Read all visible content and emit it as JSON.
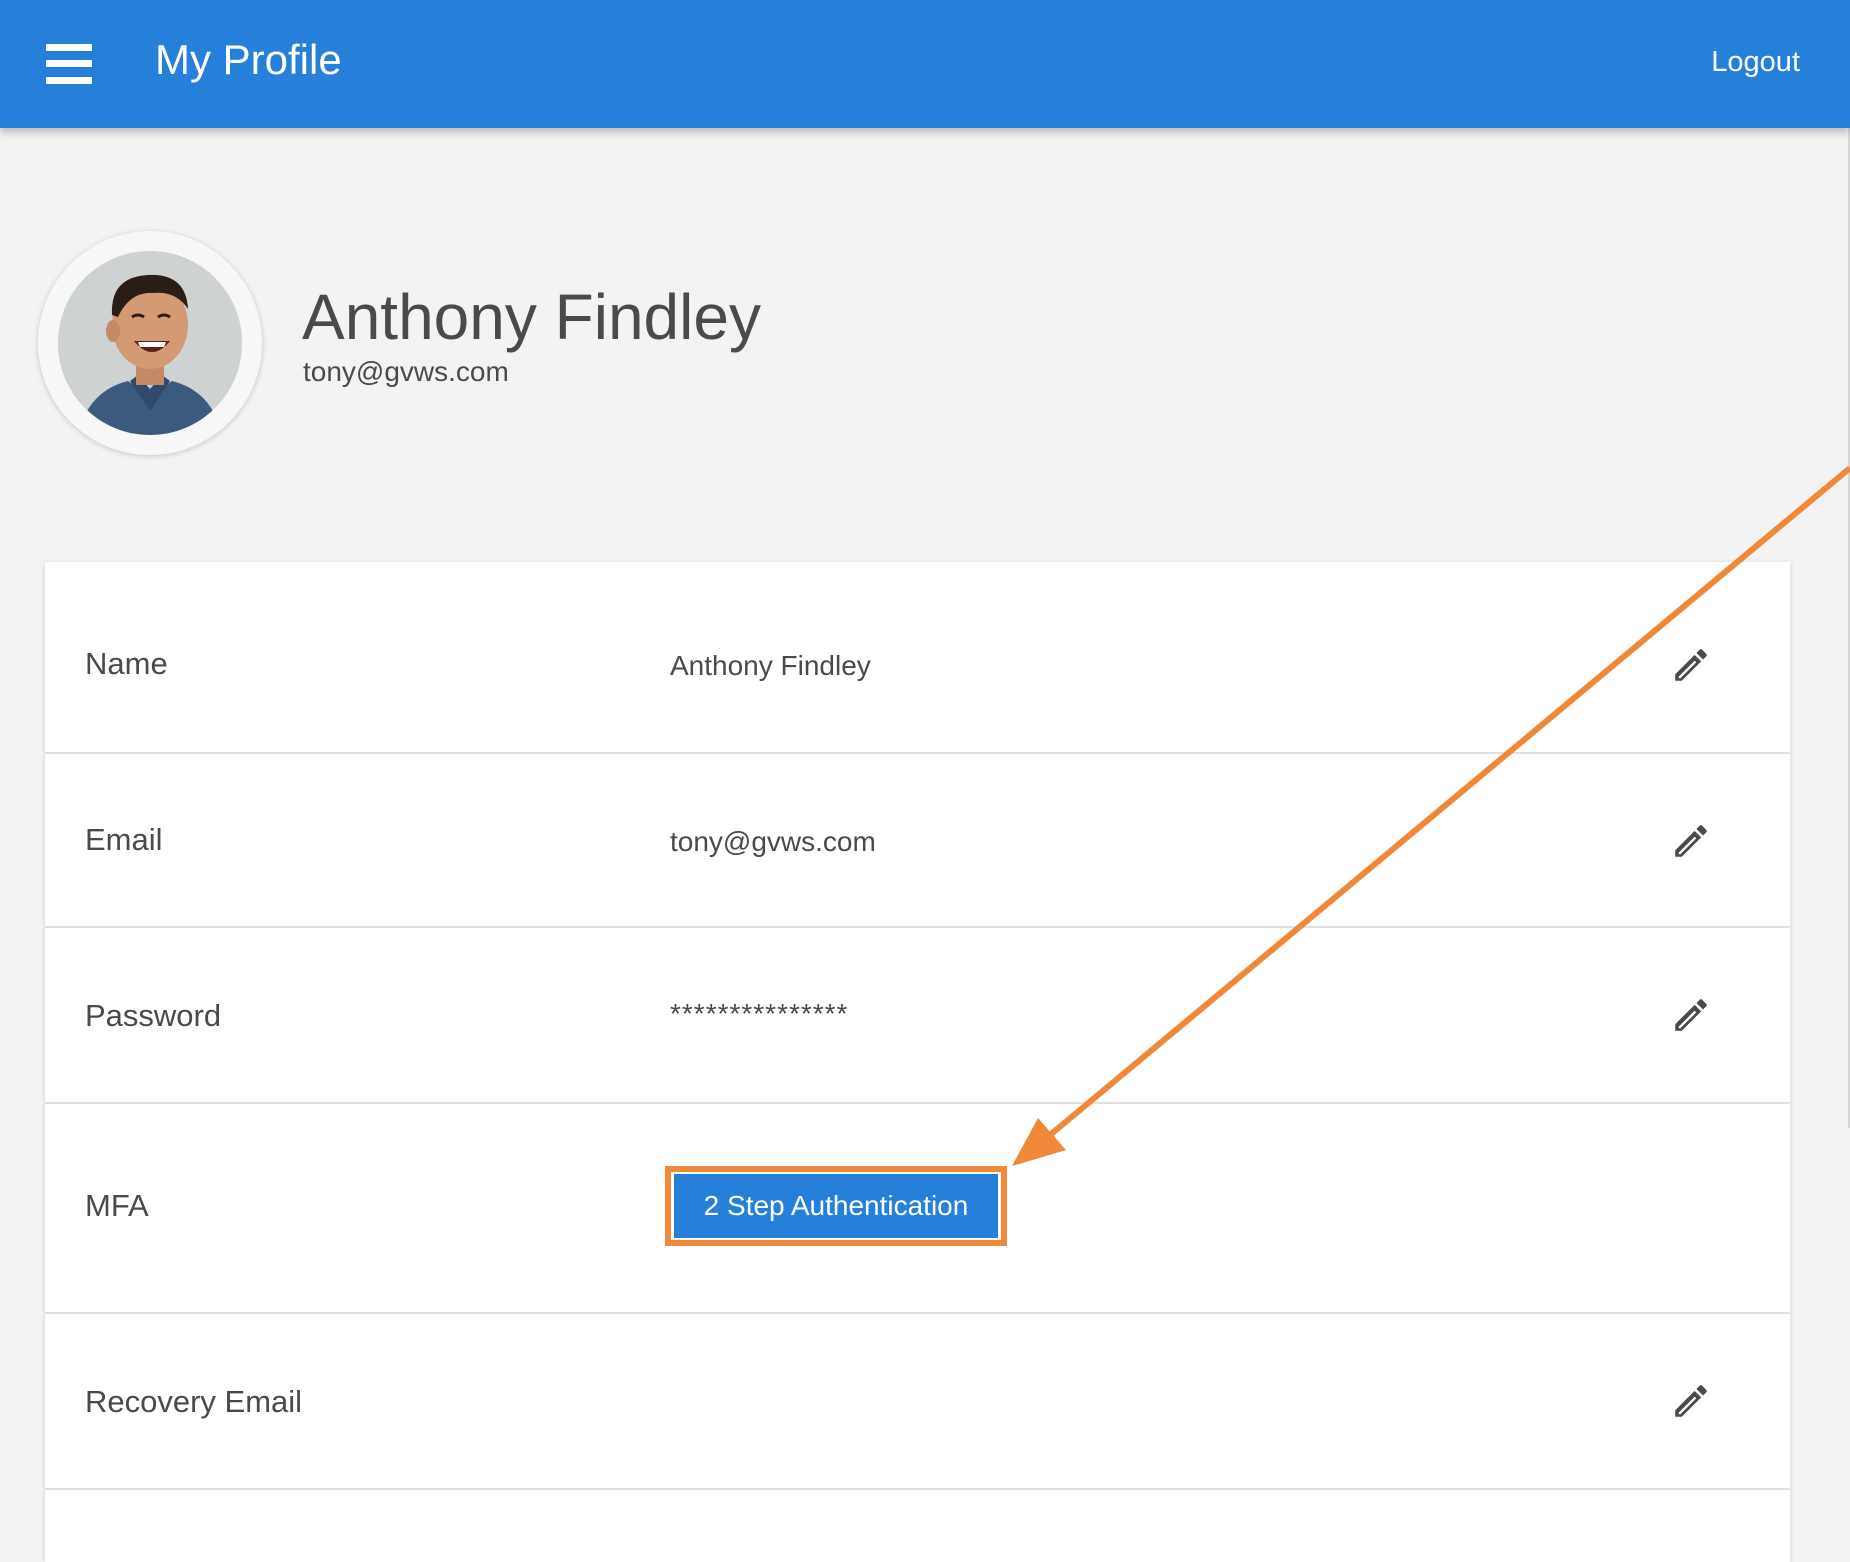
{
  "header": {
    "title": "My Profile",
    "logout_label": "Logout",
    "menu_icon": "hamburger-menu-icon"
  },
  "profile": {
    "name": "Anthony Findley",
    "email": "tony@gvws.com",
    "avatar_icon": "avatar-photo"
  },
  "fields": [
    {
      "label": "Name",
      "value": "Anthony Findley"
    },
    {
      "label": "Email",
      "value": "tony@gvws.com"
    },
    {
      "label": "Password",
      "value": "***************"
    },
    {
      "label": "MFA",
      "button_label": "2 Step Authentication"
    },
    {
      "label": "Recovery Email",
      "value": ""
    }
  ],
  "colors": {
    "header_bg": "#2680d9",
    "highlight": "#f0883a",
    "page_bg": "#f3f3f3"
  },
  "icons": {
    "edit": "pencil-icon",
    "annotation": "arrow-annotation"
  }
}
